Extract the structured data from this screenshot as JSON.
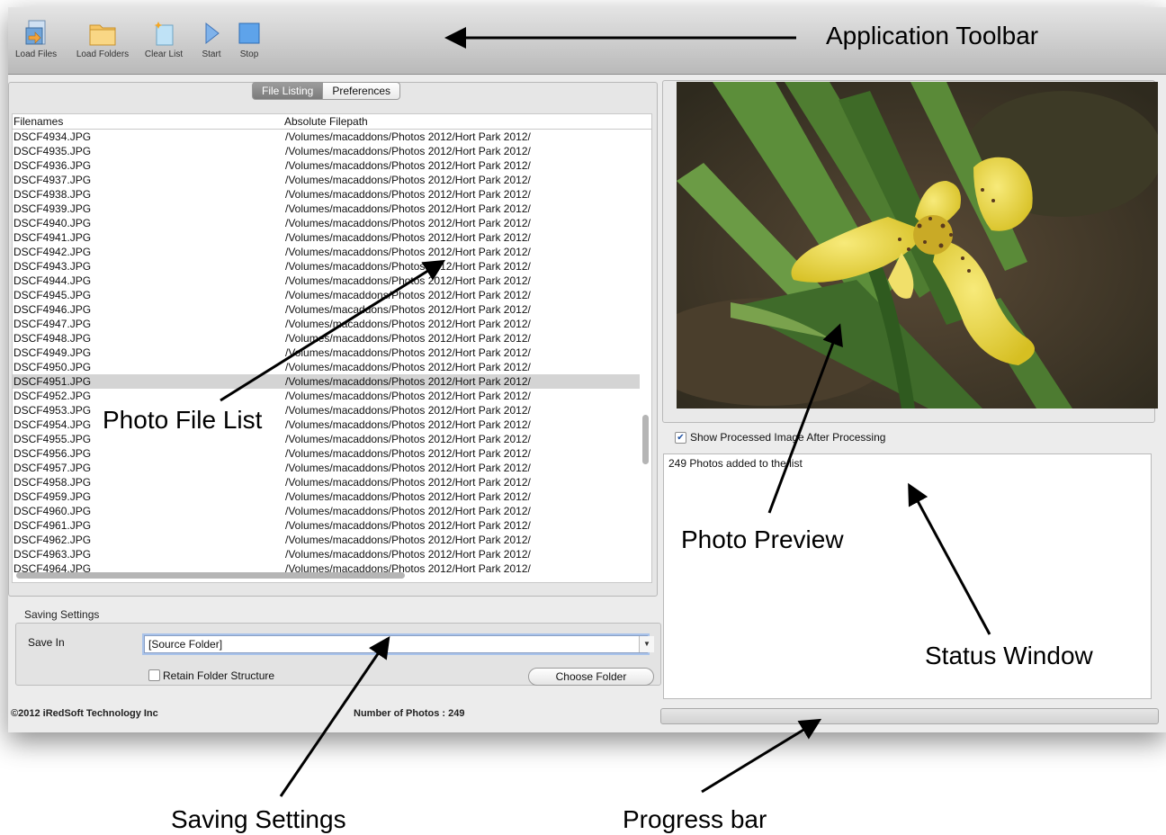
{
  "toolbar": {
    "buttons": [
      {
        "label": "Load Files",
        "icon": "load-files-icon"
      },
      {
        "label": "Load Folders",
        "icon": "folder-icon"
      },
      {
        "label": "Clear List",
        "icon": "clear-list-icon"
      },
      {
        "label": "Start",
        "icon": "play-icon"
      },
      {
        "label": "Stop",
        "icon": "stop-icon"
      }
    ]
  },
  "tabs": [
    {
      "label": "File Listing",
      "active": true
    },
    {
      "label": "Preferences",
      "active": false
    }
  ],
  "file_table": {
    "columns": [
      "Filenames",
      "Absolute Filepath"
    ],
    "rows": [
      {
        "name": "DSCF4934.JPG",
        "path": "/Volumes/macaddons/Photos 2012/Hort Park 2012/"
      },
      {
        "name": "DSCF4935.JPG",
        "path": "/Volumes/macaddons/Photos 2012/Hort Park 2012/"
      },
      {
        "name": "DSCF4936.JPG",
        "path": "/Volumes/macaddons/Photos 2012/Hort Park 2012/"
      },
      {
        "name": "DSCF4937.JPG",
        "path": "/Volumes/macaddons/Photos 2012/Hort Park 2012/"
      },
      {
        "name": "DSCF4938.JPG",
        "path": "/Volumes/macaddons/Photos 2012/Hort Park 2012/"
      },
      {
        "name": "DSCF4939.JPG",
        "path": "/Volumes/macaddons/Photos 2012/Hort Park 2012/"
      },
      {
        "name": "DSCF4940.JPG",
        "path": "/Volumes/macaddons/Photos 2012/Hort Park 2012/"
      },
      {
        "name": "DSCF4941.JPG",
        "path": "/Volumes/macaddons/Photos 2012/Hort Park 2012/"
      },
      {
        "name": "DSCF4942.JPG",
        "path": "/Volumes/macaddons/Photos 2012/Hort Park 2012/"
      },
      {
        "name": "DSCF4943.JPG",
        "path": "/Volumes/macaddons/Photos 2012/Hort Park 2012/"
      },
      {
        "name": "DSCF4944.JPG",
        "path": "/Volumes/macaddons/Photos 2012/Hort Park 2012/"
      },
      {
        "name": "DSCF4945.JPG",
        "path": "/Volumes/macaddons/Photos 2012/Hort Park 2012/"
      },
      {
        "name": "DSCF4946.JPG",
        "path": "/Volumes/macaddons/Photos 2012/Hort Park 2012/"
      },
      {
        "name": "DSCF4947.JPG",
        "path": "/Volumes/macaddons/Photos 2012/Hort Park 2012/"
      },
      {
        "name": "DSCF4948.JPG",
        "path": "/Volumes/macaddons/Photos 2012/Hort Park 2012/"
      },
      {
        "name": "DSCF4949.JPG",
        "path": "/Volumes/macaddons/Photos 2012/Hort Park 2012/"
      },
      {
        "name": "DSCF4950.JPG",
        "path": "/Volumes/macaddons/Photos 2012/Hort Park 2012/"
      },
      {
        "name": "DSCF4951.JPG",
        "path": "/Volumes/macaddons/Photos 2012/Hort Park 2012/"
      },
      {
        "name": "DSCF4952.JPG",
        "path": "/Volumes/macaddons/Photos 2012/Hort Park 2012/"
      },
      {
        "name": "DSCF4953.JPG",
        "path": "/Volumes/macaddons/Photos 2012/Hort Park 2012/"
      },
      {
        "name": "DSCF4954.JPG",
        "path": "/Volumes/macaddons/Photos 2012/Hort Park 2012/"
      },
      {
        "name": "DSCF4955.JPG",
        "path": "/Volumes/macaddons/Photos 2012/Hort Park 2012/"
      },
      {
        "name": "DSCF4956.JPG",
        "path": "/Volumes/macaddons/Photos 2012/Hort Park 2012/"
      },
      {
        "name": "DSCF4957.JPG",
        "path": "/Volumes/macaddons/Photos 2012/Hort Park 2012/"
      },
      {
        "name": "DSCF4958.JPG",
        "path": "/Volumes/macaddons/Photos 2012/Hort Park 2012/"
      },
      {
        "name": "DSCF4959.JPG",
        "path": "/Volumes/macaddons/Photos 2012/Hort Park 2012/"
      },
      {
        "name": "DSCF4960.JPG",
        "path": "/Volumes/macaddons/Photos 2012/Hort Park 2012/"
      },
      {
        "name": "DSCF4961.JPG",
        "path": "/Volumes/macaddons/Photos 2012/Hort Park 2012/"
      },
      {
        "name": "DSCF4962.JPG",
        "path": "/Volumes/macaddons/Photos 2012/Hort Park 2012/"
      },
      {
        "name": "DSCF4963.JPG",
        "path": "/Volumes/macaddons/Photos 2012/Hort Park 2012/"
      },
      {
        "name": "DSCF4964.JPG",
        "path": "/Volumes/macaddons/Photos 2012/Hort Park 2012/"
      }
    ],
    "selected_name": "DSCF4951.JPG"
  },
  "saving": {
    "title": "Saving Settings",
    "save_in_label": "Save In",
    "save_in_value": "[Source Folder]",
    "retain_label": "Retain Folder Structure",
    "retain_checked": false,
    "choose_button": "Choose Folder"
  },
  "footer": {
    "copyright": "©2012 iRedSoft Technology Inc",
    "photo_count": "Number of Photos : 249"
  },
  "preview": {
    "show_processed_label": "Show Processed Image After Processing",
    "show_processed_checked": true
  },
  "status": {
    "message": "249 Photos added to the list"
  },
  "progress": {
    "fraction": 0
  },
  "callouts": {
    "toolbar": "Application Toolbar",
    "file_list": "Photo File List",
    "preview": "Photo Preview",
    "status": "Status Window",
    "saving": "Saving Settings",
    "progress": "Progress bar"
  },
  "colors": {
    "selected_row": "#d4d4d4",
    "focus_ring": "#a9c3ea",
    "flower_yellow": "#e8d23a",
    "leaf_green": "#3f6b2a"
  }
}
